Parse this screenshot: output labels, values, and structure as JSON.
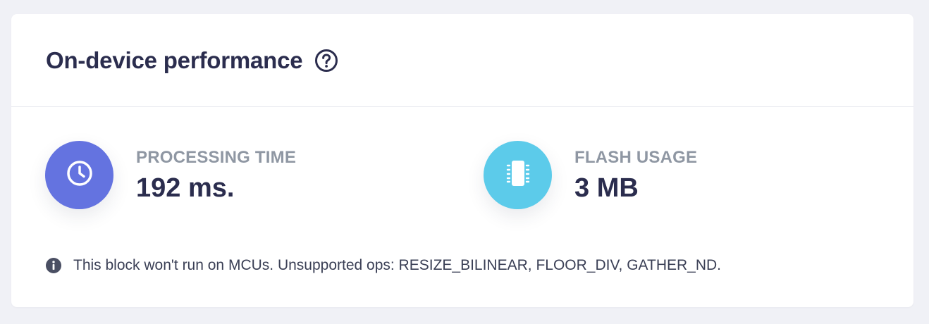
{
  "panel": {
    "title": "On-device performance",
    "help_icon": "question-circle-icon",
    "metrics": [
      {
        "label": "PROCESSING TIME",
        "value": "192 ms.",
        "icon": "clock-icon",
        "color": "#6473e0"
      },
      {
        "label": "FLASH USAGE",
        "value": "3 MB",
        "icon": "chip-icon",
        "color": "#5ccbea"
      }
    ],
    "note": {
      "icon": "info-icon",
      "text": "This block won't run on MCUs. Unsupported ops: RESIZE_BILINEAR, FLOOR_DIV, GATHER_ND."
    }
  }
}
